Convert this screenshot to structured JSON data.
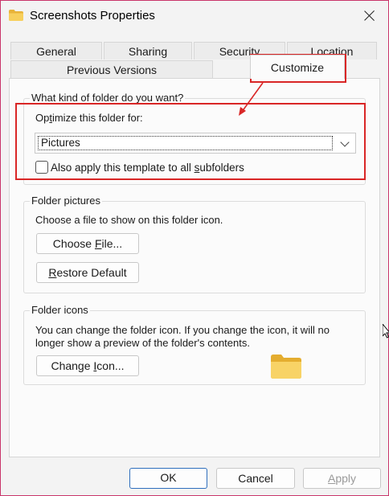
{
  "window": {
    "title": "Screenshots Properties",
    "close_icon": "close-icon",
    "title_icon": "folder-icon"
  },
  "tabs": {
    "row1": [
      "General",
      "Sharing",
      "Security",
      "Location"
    ],
    "row2": [
      "Previous Versions",
      "Customize"
    ],
    "active": "Customize"
  },
  "folder_type": {
    "group_title": "What kind of folder do you want?",
    "optimize_label": "Optimize this folder for:",
    "optimize_value": "Pictures",
    "apply_label": "Also apply this template to all subfolders",
    "apply_checked": false
  },
  "folder_pictures": {
    "group_title": "Folder pictures",
    "description": "Choose a file to show on this folder icon.",
    "choose_button": "Choose File...",
    "restore_button": "Restore Default"
  },
  "folder_icons": {
    "group_title": "Folder icons",
    "description_line1": "You can change the folder icon. If you change the icon, it will no",
    "description_line2": "longer show a preview of the folder's contents.",
    "change_button": "Change Icon..."
  },
  "footer": {
    "ok": "OK",
    "cancel": "Cancel",
    "apply": "Apply"
  },
  "colors": {
    "highlight": "#d92626",
    "folder_yellow": "#f5c842",
    "primary_border": "#2f6fbd"
  }
}
